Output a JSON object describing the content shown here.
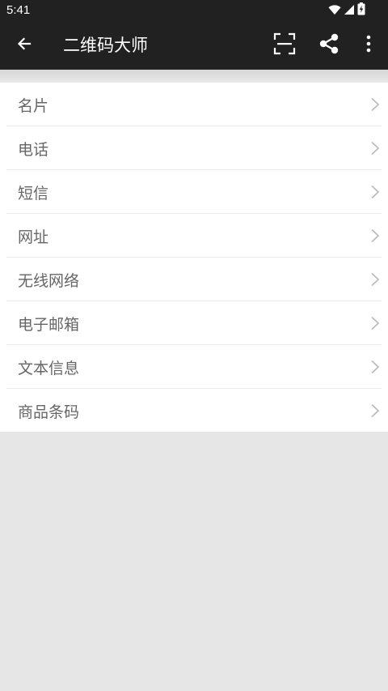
{
  "status_bar": {
    "time": "5:41",
    "icons": [
      "wifi-icon",
      "cellular-signal-icon",
      "battery-charging-icon"
    ]
  },
  "app_bar": {
    "title": "二维码大师",
    "navigation_icon": "arrow-back-icon",
    "actions": [
      "scan-icon",
      "share-icon",
      "more-vert-icon"
    ]
  },
  "list": {
    "items": [
      {
        "label": "名片"
      },
      {
        "label": "电话"
      },
      {
        "label": "短信"
      },
      {
        "label": "网址"
      },
      {
        "label": "无线网络"
      },
      {
        "label": "电子邮箱"
      },
      {
        "label": "文本信息"
      },
      {
        "label": "商品条码"
      }
    ],
    "item_icon": "chevron-right-icon"
  },
  "colors": {
    "app_bar_bg": "#212121",
    "page_bg": "#e6e6e6",
    "list_bg": "#ffffff",
    "label_text": "#666666",
    "chevron": "#bdbdbd"
  }
}
